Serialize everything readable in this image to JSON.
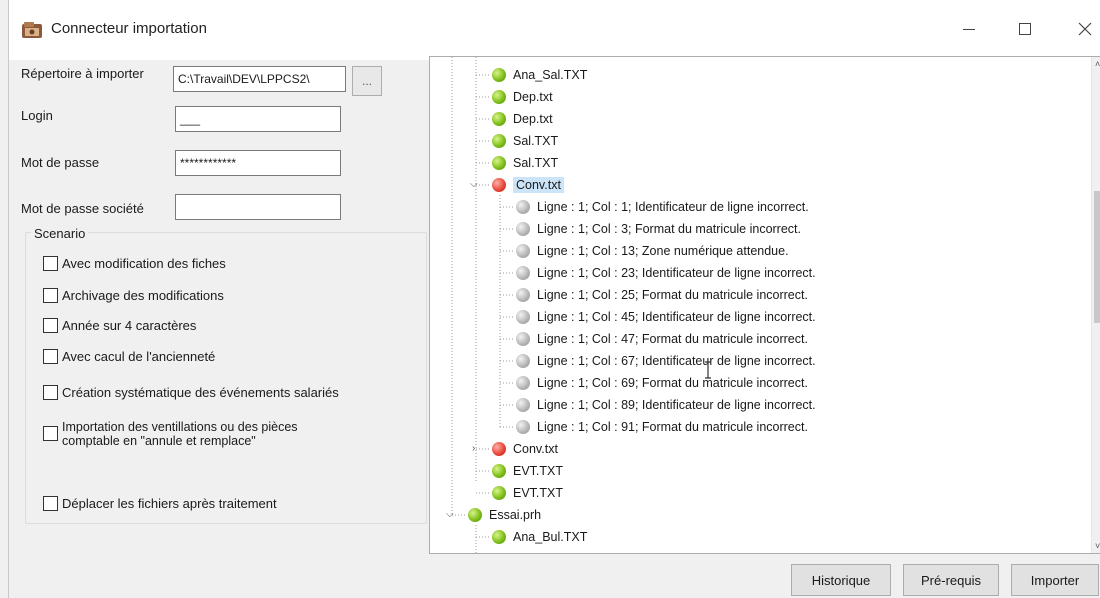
{
  "window": {
    "title": "Connecteur importation",
    "controls": {
      "minimize": "—",
      "maximize": "☐",
      "close": "✕"
    }
  },
  "form": {
    "directory_label": "Répertoire à importer",
    "directory_value": "C:\\Travail\\DEV\\LPPCS2\\",
    "browse_label": "...",
    "login_label": "Login",
    "login_value": "___",
    "password_label": "Mot de passe",
    "password_value": "************",
    "company_password_label": "Mot de passe société",
    "company_password_value": ""
  },
  "scenario": {
    "legend": "Scenario",
    "options": [
      {
        "label": "Avec modification des fiches",
        "checked": false
      },
      {
        "label": "Archivage des modifications",
        "checked": false
      },
      {
        "label": "Année sur 4 caractères",
        "checked": false
      },
      {
        "label": "Avec cacul de l'ancienneté",
        "checked": false
      },
      {
        "label": "Création systématique des événements salariés",
        "checked": false
      },
      {
        "label": "Importation des ventillations ou des pièces comptable en \"annule et remplace\"",
        "checked": false
      },
      {
        "label": "Déplacer les fichiers après traitement",
        "checked": false
      }
    ]
  },
  "tree": {
    "nodes": [
      {
        "text": "Ana_Sal.TXT",
        "status": "green"
      },
      {
        "text": "Dep.txt",
        "status": "green"
      },
      {
        "text": "Dep.txt",
        "status": "green"
      },
      {
        "text": "Sal.TXT",
        "status": "green"
      },
      {
        "text": "Sal.TXT",
        "status": "green"
      },
      {
        "text": "Conv.txt",
        "status": "red",
        "expanded": true,
        "selected": true
      },
      {
        "text": "Ligne : 1; Col : 1; Identificateur de ligne incorrect.",
        "status": "grey"
      },
      {
        "text": "Ligne : 1; Col : 3; Format du matricule incorrect.",
        "status": "grey"
      },
      {
        "text": "Ligne : 1; Col : 13; Zone numérique attendue.",
        "status": "grey"
      },
      {
        "text": "Ligne : 1; Col : 23; Identificateur de ligne incorrect.",
        "status": "grey"
      },
      {
        "text": "Ligne : 1; Col : 25; Format du matricule incorrect.",
        "status": "grey"
      },
      {
        "text": "Ligne : 1; Col : 45; Identificateur de ligne incorrect.",
        "status": "grey"
      },
      {
        "text": "Ligne : 1; Col : 47; Format du matricule incorrect.",
        "status": "grey"
      },
      {
        "text": "Ligne : 1; Col : 67; Identificateur de ligne incorrect.",
        "status": "grey"
      },
      {
        "text": "Ligne : 1; Col : 69; Format du matricule incorrect.",
        "status": "grey"
      },
      {
        "text": "Ligne : 1; Col : 89; Identificateur de ligne incorrect.",
        "status": "grey"
      },
      {
        "text": "Ligne : 1; Col : 91; Format du matricule incorrect.",
        "status": "grey"
      },
      {
        "text": "Conv.txt",
        "status": "red",
        "expanded": false
      },
      {
        "text": "EVT.TXT",
        "status": "green"
      },
      {
        "text": "EVT.TXT",
        "status": "green"
      },
      {
        "text": "Essai.prh",
        "status": "green",
        "expanded": true
      },
      {
        "text": "Ana_Bul.TXT",
        "status": "green"
      }
    ],
    "scroll_up": "˄",
    "scroll_down": "˅"
  },
  "buttons": {
    "history": "Historique",
    "prereq": "Pré-requis",
    "import": "Importer"
  },
  "colors": {
    "status_green": "#7fbf1a",
    "status_red": "#e8483a",
    "status_grey": "#b8b8b8",
    "selection": "#cce4f7"
  }
}
